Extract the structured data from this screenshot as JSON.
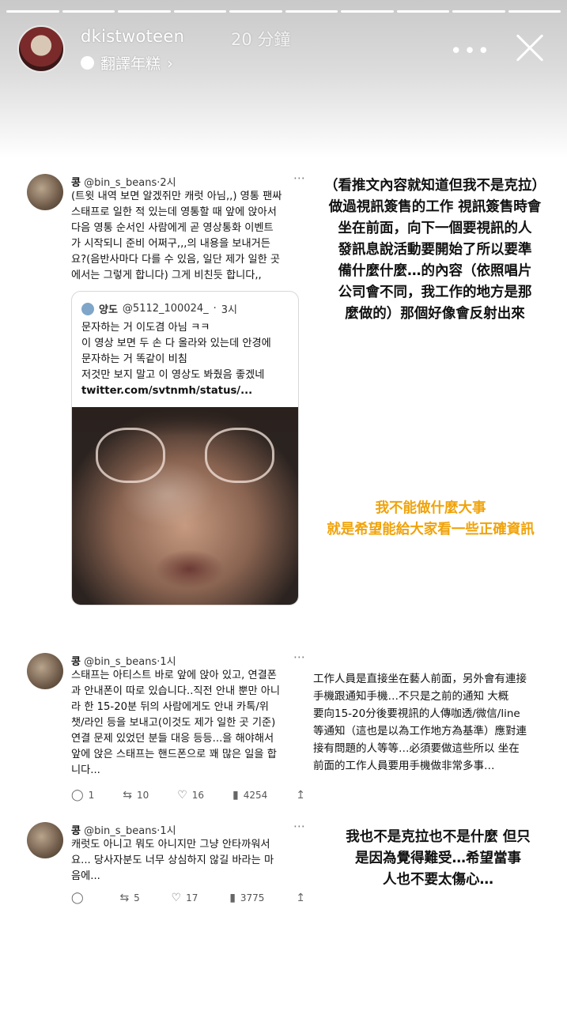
{
  "story": {
    "username": "dkistwoteen",
    "time": "20 分鐘",
    "translate_label": "翻譯年糕",
    "more_icon": "more-dots-icon",
    "close_icon": "close-icon",
    "progress_segments": 10
  },
  "tweets": [
    {
      "name": "콩",
      "handle": "@bin_s_beans",
      "time": "2시",
      "lines": [
        "(트윗 내역 보면 알겠쥐만 캐럿 아님,,) 영통 팬싸",
        "스태프로 일한 적 있는데 영통할 때 앞에 앉아서",
        "다음 영통 순서인 사람에게 곧 영상통화 이벤트",
        "가 시작되니 준비 어쩌구,,,의 내용을 보내거든",
        "요?(음반사마다 다를 수 있음, 일단 제가 일한 곳",
        "에서는 그렇게 합니다) 그게 비친듯 합니다,,"
      ],
      "quote": {
        "name": "양도",
        "handle": "@5112_100024_",
        "time": "3시",
        "lines": [
          "문자하는 거 이도겸 아님 ㅋㅋ",
          "이 영상 보면 두 손 다 올라와 있는데 안경에",
          "문자하는 거 똑같이 비침",
          "저것만 보지 말고 이 영상도 봐줬음 좋겠네"
        ],
        "link": "twitter.com/svtnmh/status/..."
      }
    },
    {
      "name": "콩",
      "handle": "@bin_s_beans",
      "time": "1시",
      "lines": [
        "스태프는 아티스트 바로 앞에 앉아 있고, 연결폰",
        "과 안내폰이 따로 있습니다..직전 안내 뿐만 아니",
        "라 한 15-20분 뒤의 사람에게도 안내 카톡/위",
        "챗/라인 등을 보내고(이것도 제가 일한 곳 기준)",
        "연결 문제 있었던 분들 대응 등등...을 해야해서",
        "앞에 앉은 스태프는 핸드폰으로 꽤 많은 일을 합",
        "니다..."
      ],
      "replies": "1",
      "retweets": "10",
      "likes": "16",
      "views": "4254"
    },
    {
      "name": "콩",
      "handle": "@bin_s_beans",
      "time": "1시",
      "lines": [
        "캐럿도 아니고 뭐도 아니지만 그냥 안타까워서",
        "요... 당사자분도 너무 상심하지 않길 바라는 마",
        "음에..."
      ],
      "replies": "",
      "retweets": "5",
      "likes": "17",
      "views": "3775"
    }
  ],
  "captions": {
    "c1": [
      "（看推文內容就知道但我不是克拉）",
      "做過視訊簽售的工作 視訊簽售時會",
      "坐在前面，向下一個要視訊的人",
      "發訊息說活動要開始了所以要準",
      "備什麼什麼…的內容（依照唱片",
      "公司會不同，我工作的地方是那",
      "麼做的）那個好像會反射出來"
    ],
    "c2": [
      "我不能做什麼大事",
      "就是希望能給大家看一些正確資訊"
    ],
    "c3": [
      "工作人員是直接坐在藝人前面，另外會有連接",
      "手機跟通知手機…不只是之前的通知 大概",
      "要向15-20分後要視訊的人傳咖透/微信/line",
      "等通知（這也是以為工作地方為基準）應對連",
      "接有問題的人等等…必須要做這些所以 坐在",
      "前面的工作人員要用手機做非常多事…"
    ],
    "c4": [
      "我也不是克拉也不是什麼 但只",
      "是因為覺得難受…希望當事",
      "人也不要太傷心…"
    ]
  },
  "colors": {
    "highlight": "#f0a30a"
  }
}
